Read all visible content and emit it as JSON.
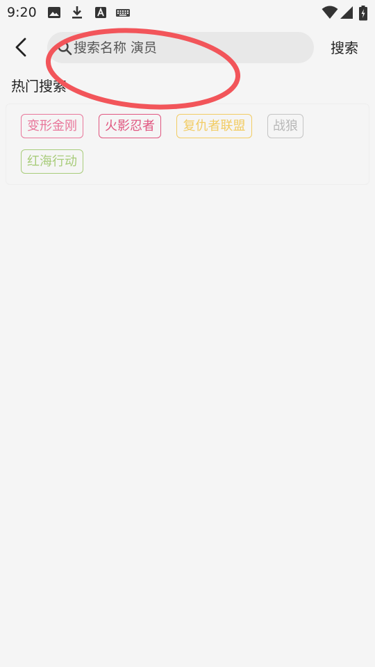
{
  "status_bar": {
    "time": "9:20",
    "icons": [
      "image-icon",
      "download-icon",
      "text-a-icon",
      "keyboard-icon",
      "wifi-icon",
      "signal-icon",
      "battery-icon"
    ]
  },
  "header": {
    "back_icon": "chevron-left-icon",
    "search": {
      "icon": "search-icon",
      "value": "",
      "placeholder": "搜索名称 演员"
    },
    "search_button": "搜索"
  },
  "hot_search": {
    "title": "热门搜索",
    "tags": [
      {
        "label": "变形金刚",
        "color": "#e8769a"
      },
      {
        "label": "火影忍者",
        "color": "#e0557f"
      },
      {
        "label": "复仇者联盟",
        "color": "#f2cc63"
      },
      {
        "label": "战狼",
        "color": "#b8b8b8"
      },
      {
        "label": "红海行动",
        "color": "#a8cc7a"
      }
    ]
  },
  "colors": {
    "background": "#f5f5f5",
    "search_field": "#e8e8e8",
    "annotation_ellipse": "#f2555a"
  }
}
